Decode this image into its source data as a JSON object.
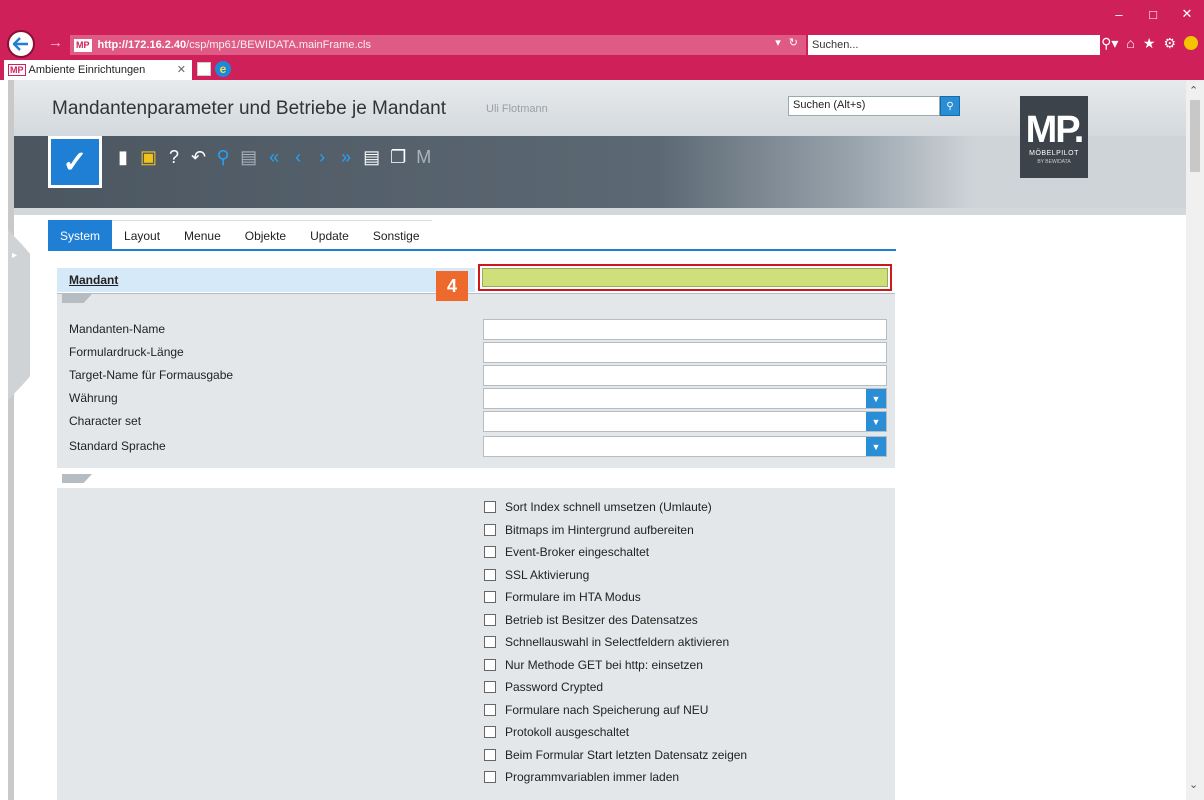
{
  "browser": {
    "url_host": "http://172.16.2.40",
    "url_path": "/csp/mp61/BEWIDATA.mainFrame.cls",
    "url_logo": "MP",
    "search_placeholder": "Suchen...",
    "tab_title": "Ambiente Einrichtungen",
    "tab_logo": "MP"
  },
  "app": {
    "title": "Mandantenparameter und Betriebe je Mandant",
    "user": "Uli Flotmann",
    "search_value": "Suchen (Alt+s)",
    "logo_main": "MP.",
    "logo_sub": "MÖBELPILOT",
    "logo_tiny": "BY BEWIDATA",
    "toolbar_last": "M"
  },
  "tabs": [
    {
      "label": "System"
    },
    {
      "label": "Layout"
    },
    {
      "label": "Menue"
    },
    {
      "label": "Objekte"
    },
    {
      "label": "Update"
    },
    {
      "label": "Sonstige"
    }
  ],
  "form": {
    "mandant_label": "Mandant",
    "mandant_value": "",
    "step_badge": "4",
    "fields": [
      {
        "label": "Mandanten-Name",
        "value": ""
      },
      {
        "label": "Formulardruck-Länge",
        "value": ""
      },
      {
        "label": "Target-Name für Formausgabe",
        "value": ""
      },
      {
        "label": "Währung",
        "value": ""
      },
      {
        "label": "Character set",
        "value": ""
      },
      {
        "label": "Standard Sprache",
        "value": ""
      }
    ]
  },
  "checkboxes": [
    {
      "label": "Sort Index schnell umsetzen (Umlaute)",
      "checked": false
    },
    {
      "label": "Bitmaps im Hintergrund aufbereiten",
      "checked": false
    },
    {
      "label": "Event-Broker eingeschaltet",
      "checked": false
    },
    {
      "label": "SSL Aktivierung",
      "checked": false
    },
    {
      "label": "Formulare im HTA Modus",
      "checked": false
    },
    {
      "label": "Betrieb ist Besitzer des Datensatzes",
      "checked": false
    },
    {
      "label": "Schnellauswahl in Selectfeldern aktivieren",
      "checked": false
    },
    {
      "label": "Nur Methode GET bei http: einsetzen",
      "checked": false
    },
    {
      "label": "Password Crypted",
      "checked": false
    },
    {
      "label": "Formulare nach Speicherung auf NEU",
      "checked": false
    },
    {
      "label": "Protokoll ausgeschaltet",
      "checked": false
    },
    {
      "label": "Beim Formular Start letzten Datensatz zeigen",
      "checked": false
    },
    {
      "label": "Programmvariablen immer laden",
      "checked": false
    }
  ],
  "colors": {
    "browser_chrome": "#d0205a",
    "accent_blue": "#1f7fd4",
    "highlight_field": "#cfe07a",
    "step_badge": "#ee6a2c"
  }
}
